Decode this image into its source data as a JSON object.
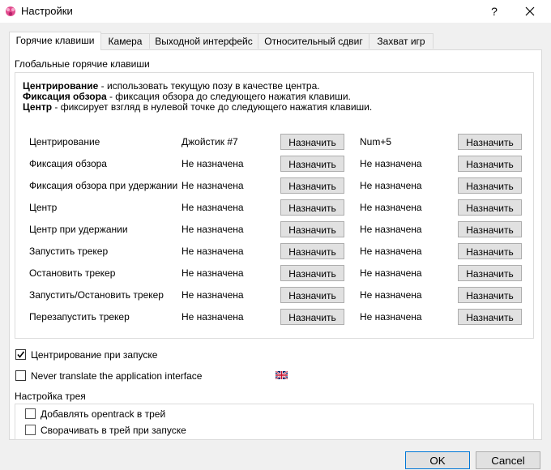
{
  "window": {
    "title": "Настройки",
    "help_glyph": "?",
    "close_glyph": "✕"
  },
  "tabs": [
    {
      "label": "Горячие клавиши",
      "active": true
    },
    {
      "label": "Камера",
      "active": false
    },
    {
      "label": "Выходной интерфейс",
      "active": false
    },
    {
      "label": "Относительный сдвиг",
      "active": false
    },
    {
      "label": "Захват игр",
      "active": false
    }
  ],
  "hotkeys": {
    "group_title": "Глобальные горячие клавиши",
    "descriptions": [
      {
        "bold": "Центрирование",
        "text": " - использовать текущую позу в качестве центра."
      },
      {
        "bold": "Фиксация обзора",
        "text": " - фиксация обзора до следующего нажатия клавиши."
      },
      {
        "bold": "Центр",
        "text": " - фиксирует взгляд в нулевой точке до следующего нажатия клавиши."
      }
    ],
    "assign_label": "Назначить",
    "rows": [
      {
        "name": "Центрирование",
        "binding1": "Джойстик #7",
        "binding2": "Num+5"
      },
      {
        "name": "Фиксация обзора",
        "binding1": "Не назначена",
        "binding2": "Не назначена"
      },
      {
        "name": "Фиксация обзора при удержании",
        "binding1": "Не назначена",
        "binding2": "Не назначена"
      },
      {
        "name": "Центр",
        "binding1": "Не назначена",
        "binding2": "Не назначена"
      },
      {
        "name": "Центр при удержании",
        "binding1": "Не назначена",
        "binding2": "Не назначена"
      },
      {
        "name": "Запустить трекер",
        "binding1": "Не назначена",
        "binding2": "Не назначена"
      },
      {
        "name": "Остановить трекер",
        "binding1": "Не назначена",
        "binding2": "Не назначена"
      },
      {
        "name": "Запустить/Остановить трекер",
        "binding1": "Не назначена",
        "binding2": "Не назначена"
      },
      {
        "name": "Перезапустить трекер",
        "binding1": "Не назначена",
        "binding2": "Не назначена"
      }
    ]
  },
  "options": {
    "center_at_startup": {
      "label": "Центрирование при запуске",
      "checked": true
    },
    "never_translate": {
      "label": "Never translate the application interface",
      "checked": false,
      "icon": "uk-flag-icon"
    }
  },
  "tray": {
    "group_title": "Настройка трея",
    "add_to_tray": {
      "label": "Добавлять opentrack в трей",
      "checked": false
    },
    "minimize_to_tray": {
      "label": "Сворачивать в трей при запуске",
      "checked": false
    }
  },
  "footer": {
    "ok_label": "OK",
    "cancel_label": "Cancel"
  },
  "colors": {
    "accent": "#0078d7",
    "button_face": "#e1e1e1",
    "button_border": "#adadad"
  }
}
